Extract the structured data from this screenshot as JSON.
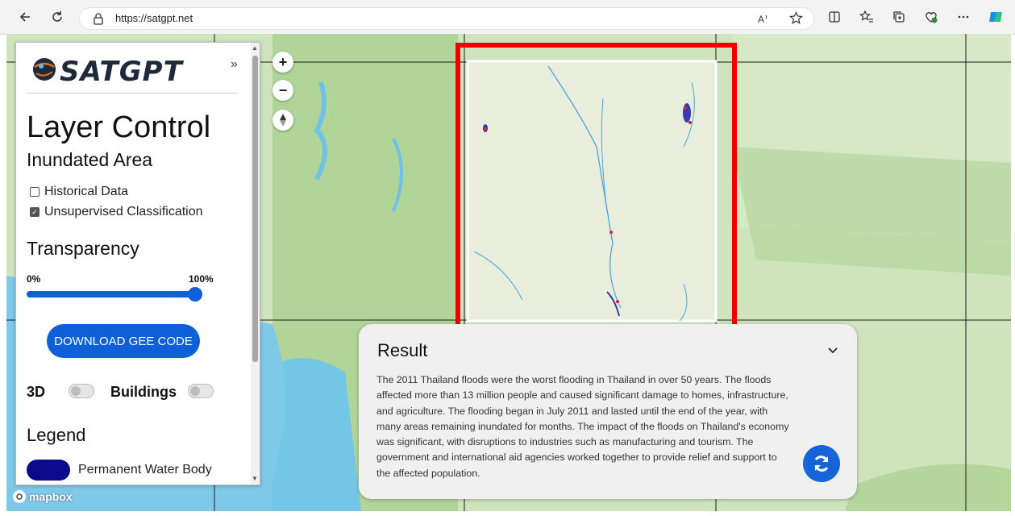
{
  "browser": {
    "url": "https://satgpt.net"
  },
  "sidebar": {
    "logo_text": "SATGPT",
    "collapse_symbol": "»",
    "title": "Layer Control",
    "subtitle": "Inundated Area",
    "checkboxes": [
      {
        "label": "Historical Data",
        "checked": false
      },
      {
        "label": "Unsupervised Classification",
        "checked": true
      }
    ],
    "transparency": {
      "title": "Transparency",
      "min_label": "0%",
      "max_label": "100%",
      "value_percent": 100
    },
    "download_button": "DOWNLOAD GEE CODE",
    "toggles": [
      {
        "label": "3D",
        "on": false
      },
      {
        "label": "Buildings",
        "on": false
      }
    ],
    "legend": {
      "title": "Legend",
      "items": [
        {
          "label": "Permanent Water Body",
          "color": "#0a0a8c"
        }
      ]
    }
  },
  "map": {
    "attribution_logo": "mapbox",
    "controls": [
      "zoom-in",
      "zoom-out",
      "compass"
    ],
    "highlight_color": "#ee0000"
  },
  "result": {
    "title": "Result",
    "text": "The 2011 Thailand floods were the worst flooding in Thailand in over 50 years. The floods affected more than 13 million people and caused significant damage to homes, infrastructure, and agriculture. The flooding began in July 2011 and lasted until the end of the year, with many areas remaining inundated for months. The impact of the floods on Thailand's economy was significant, with disruptions to industries such as manufacturing and tourism. The government and international aid agencies worked together to provide relief and support to the affected population.",
    "accent": "#1565d8"
  }
}
